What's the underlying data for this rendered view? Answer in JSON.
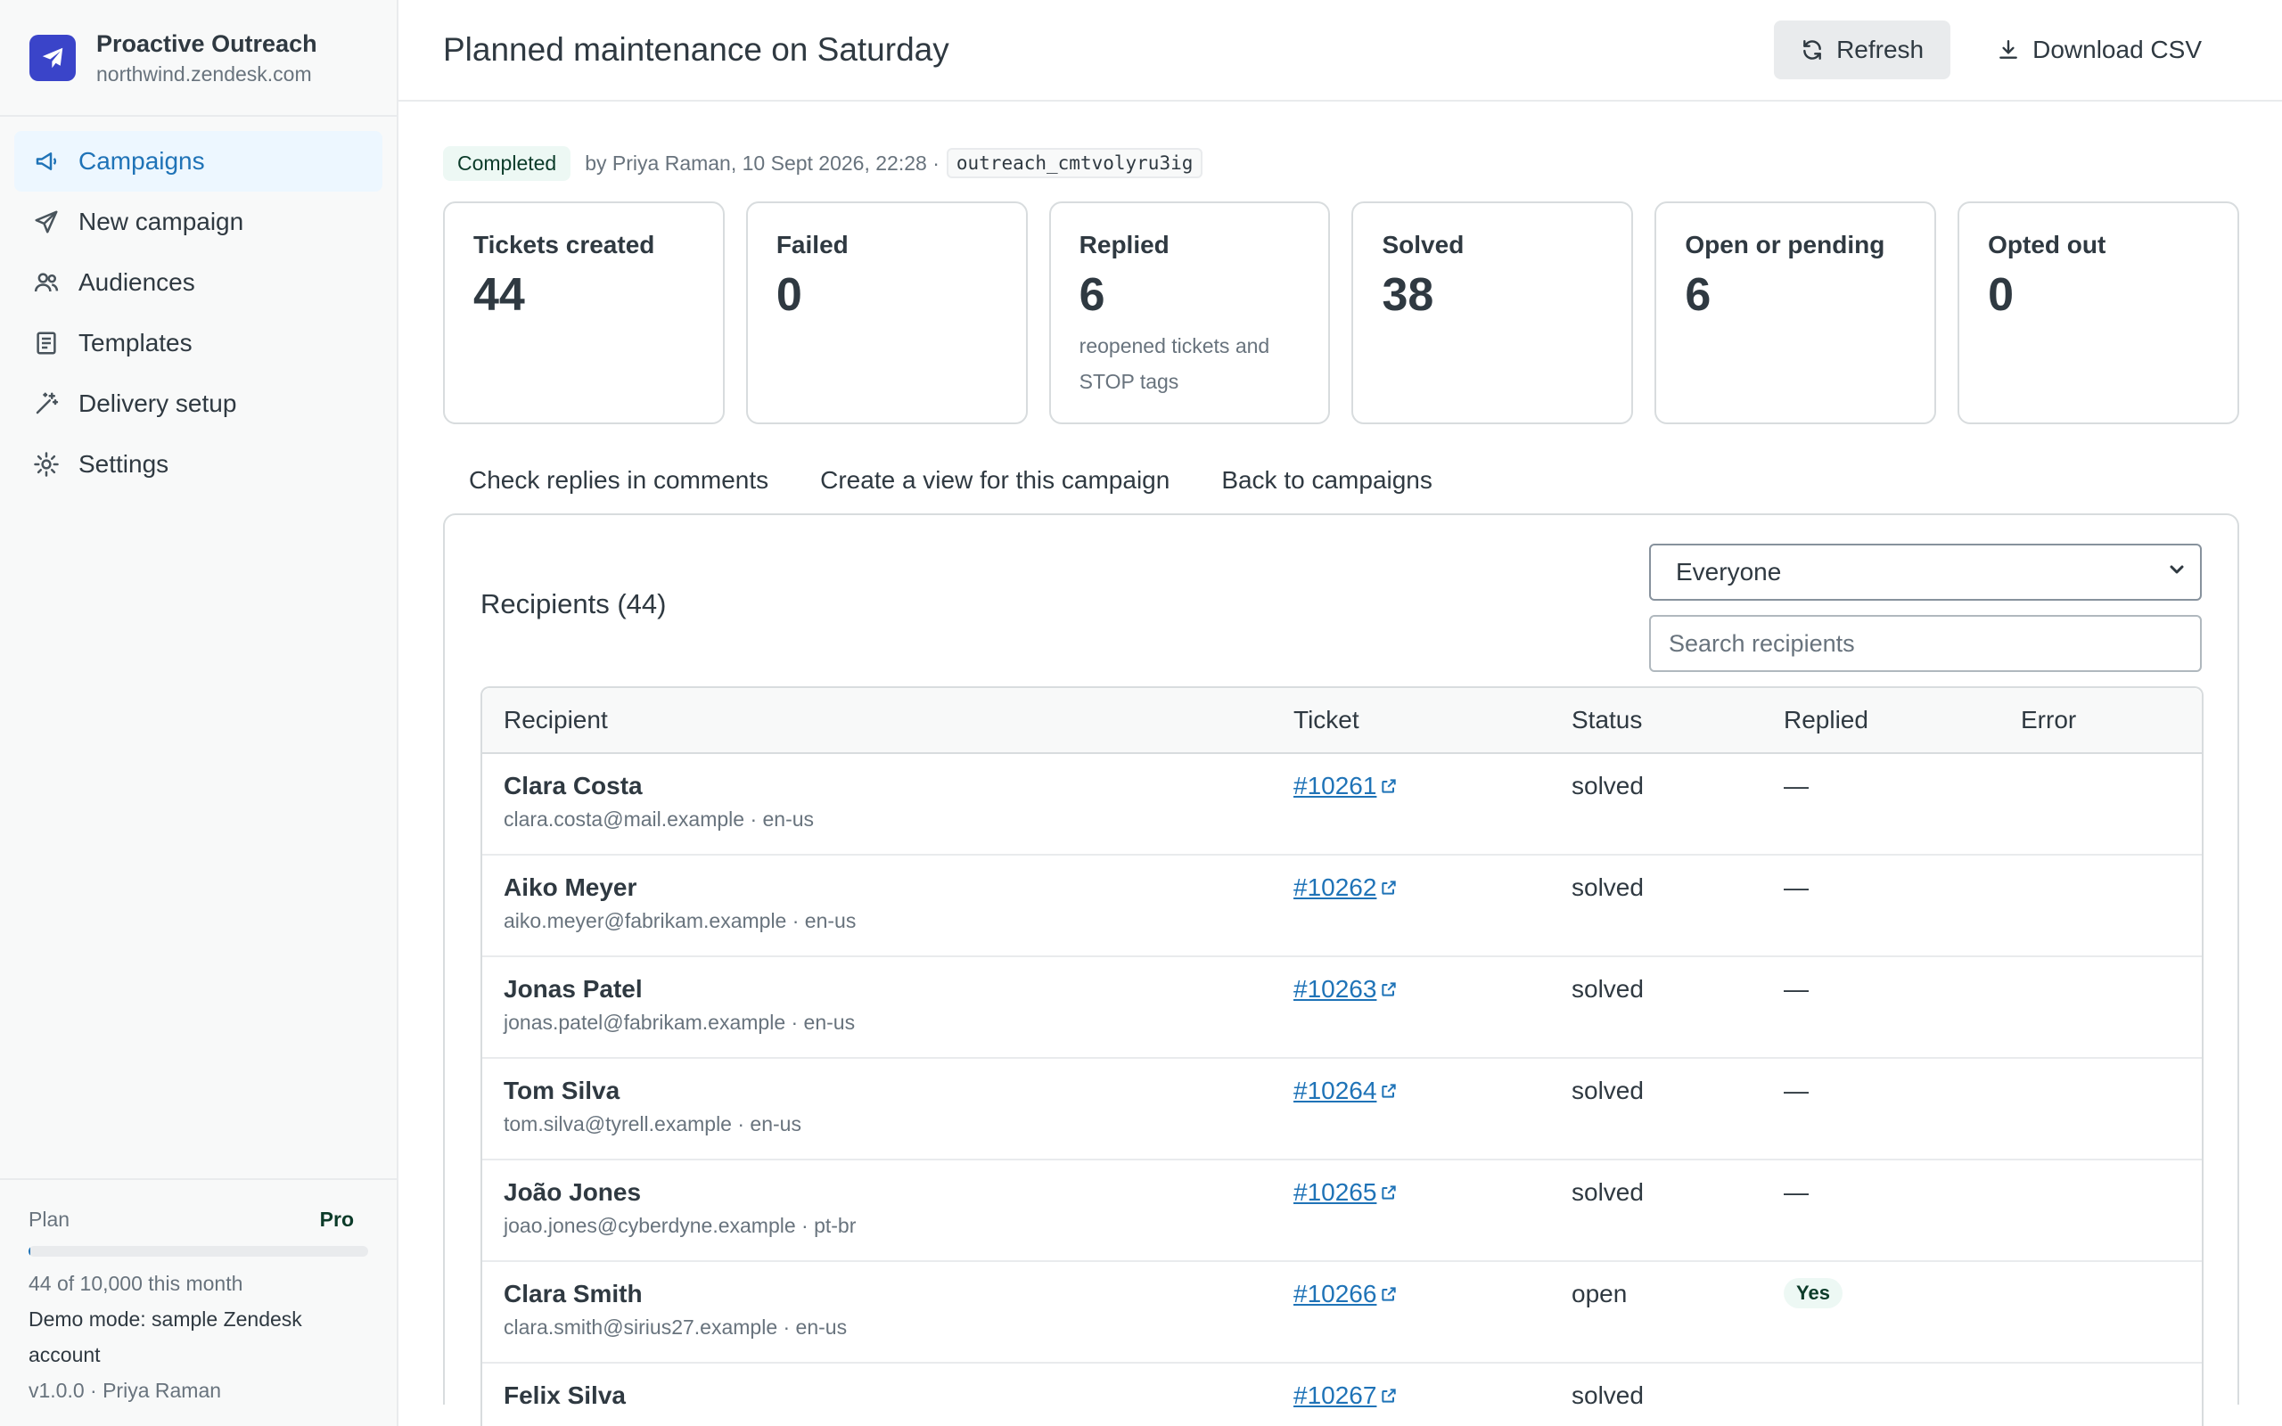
{
  "app": {
    "name": "Proactive Outreach",
    "domain": "northwind.zendesk.com"
  },
  "nav": {
    "items": [
      {
        "label": "Campaigns",
        "icon": "megaphone-icon"
      },
      {
        "label": "New campaign",
        "icon": "send-icon"
      },
      {
        "label": "Audiences",
        "icon": "users-icon"
      },
      {
        "label": "Templates",
        "icon": "document-icon"
      },
      {
        "label": "Delivery setup",
        "icon": "wand-icon"
      },
      {
        "label": "Settings",
        "icon": "gear-icon"
      }
    ],
    "active_index": 0
  },
  "plan": {
    "label": "Plan",
    "tier": "Pro",
    "usage_fraction": 0.0044,
    "usage_text": "44 of 10,000 this month",
    "demo_text": "Demo mode: sample Zendesk account",
    "version_text": "v1.0.0 · Priya Raman"
  },
  "header": {
    "title": "Planned maintenance on Saturday",
    "refresh_label": "Refresh",
    "download_label": "Download CSV"
  },
  "campaign": {
    "status": "Completed",
    "byline": "by Priya Raman, 10 Sept 2026, 22:28 ·",
    "id": "outreach_cmtvolyru3ig"
  },
  "stats": [
    {
      "label": "Tickets created",
      "value": "44",
      "note": ""
    },
    {
      "label": "Failed",
      "value": "0",
      "note": ""
    },
    {
      "label": "Replied",
      "value": "6",
      "note": "reopened tickets and STOP tags"
    },
    {
      "label": "Solved",
      "value": "38",
      "note": ""
    },
    {
      "label": "Open or pending",
      "value": "6",
      "note": ""
    },
    {
      "label": "Opted out",
      "value": "0",
      "note": ""
    }
  ],
  "links": {
    "check_replies": "Check replies in comments",
    "create_view": "Create a view for this campaign",
    "back": "Back to campaigns"
  },
  "recipients": {
    "title": "Recipients (44)",
    "filter_selected": "Everyone",
    "search_placeholder": "Search recipients",
    "columns": [
      "Recipient",
      "Ticket",
      "Status",
      "Replied",
      "Error"
    ],
    "rows": [
      {
        "name": "Clara Costa",
        "sub": "clara.costa@mail.example · en-us",
        "ticket": "#10261",
        "status": "solved",
        "replied": "—",
        "replied_yes": false,
        "error": ""
      },
      {
        "name": "Aiko Meyer",
        "sub": "aiko.meyer@fabrikam.example · en-us",
        "ticket": "#10262",
        "status": "solved",
        "replied": "—",
        "replied_yes": false,
        "error": ""
      },
      {
        "name": "Jonas Patel",
        "sub": "jonas.patel@fabrikam.example · en-us",
        "ticket": "#10263",
        "status": "solved",
        "replied": "—",
        "replied_yes": false,
        "error": ""
      },
      {
        "name": "Tom Silva",
        "sub": "tom.silva@tyrell.example · en-us",
        "ticket": "#10264",
        "status": "solved",
        "replied": "—",
        "replied_yes": false,
        "error": ""
      },
      {
        "name": "João Jones",
        "sub": "joao.jones@cyberdyne.example · pt-br",
        "ticket": "#10265",
        "status": "solved",
        "replied": "—",
        "replied_yes": false,
        "error": ""
      },
      {
        "name": "Clara Smith",
        "sub": "clara.smith@sirius27.example · en-us",
        "ticket": "#10266",
        "status": "open",
        "replied": "Yes",
        "replied_yes": true,
        "error": ""
      },
      {
        "name": "Felix Silva",
        "sub": "",
        "ticket": "#10267",
        "status": "solved",
        "replied": "",
        "replied_yes": false,
        "error": ""
      }
    ]
  },
  "colors": {
    "brand": "#3a44c9",
    "link": "#1f73b7",
    "success_bg": "#edf8f4",
    "success_text": "#0b3b29"
  }
}
